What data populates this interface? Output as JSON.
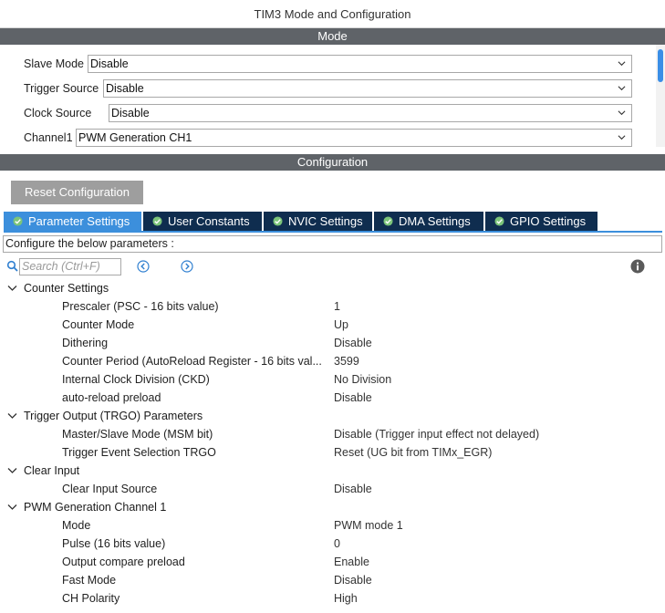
{
  "window": {
    "title": "TIM3 Mode and Configuration"
  },
  "mode_section": {
    "header": "Mode",
    "fields": [
      {
        "label": "Slave Mode",
        "value": "Disable"
      },
      {
        "label": "Trigger Source",
        "value": "Disable"
      },
      {
        "label": "Clock Source",
        "value": "Disable"
      },
      {
        "label": "Channel1",
        "value": "PWM Generation CH1"
      }
    ]
  },
  "config_section": {
    "header": "Configuration",
    "reset_label": "Reset Configuration",
    "tabs": [
      {
        "label": "Parameter Settings",
        "active": true
      },
      {
        "label": "User Constants",
        "active": false
      },
      {
        "label": "NVIC Settings",
        "active": false
      },
      {
        "label": "DMA Settings",
        "active": false
      },
      {
        "label": "GPIO Settings",
        "active": false
      }
    ],
    "description": "Configure the below parameters :",
    "search_placeholder": "Search (Ctrl+F)"
  },
  "groups": [
    {
      "label": "Counter Settings",
      "params": [
        {
          "name": "Prescaler (PSC - 16 bits value)",
          "value": "1"
        },
        {
          "name": "Counter Mode",
          "value": "Up"
        },
        {
          "name": "Dithering",
          "value": "Disable"
        },
        {
          "name": "Counter Period (AutoReload Register - 16 bits val...",
          "value": "3599"
        },
        {
          "name": "Internal Clock Division (CKD)",
          "value": "No Division"
        },
        {
          "name": "auto-reload preload",
          "value": "Disable"
        }
      ]
    },
    {
      "label": "Trigger Output (TRGO) Parameters",
      "params": [
        {
          "name": "Master/Slave Mode (MSM bit)",
          "value": "Disable (Trigger input effect not delayed)"
        },
        {
          "name": "Trigger Event Selection TRGO",
          "value": "Reset (UG bit from TIMx_EGR)"
        }
      ]
    },
    {
      "label": "Clear Input",
      "params": [
        {
          "name": "Clear Input Source",
          "value": "Disable"
        }
      ]
    },
    {
      "label": "PWM Generation Channel 1",
      "params": [
        {
          "name": "Mode",
          "value": "PWM mode 1"
        },
        {
          "name": "Pulse (16 bits value)",
          "value": "0"
        },
        {
          "name": "Output compare preload",
          "value": "Enable"
        },
        {
          "name": "Fast Mode",
          "value": "Disable"
        },
        {
          "name": "CH Polarity",
          "value": "High"
        }
      ]
    }
  ],
  "colors": {
    "section_header": "#5f6368",
    "tab_active": "#3c8fdc",
    "tab_inactive": "#0f2d4f",
    "reset_button": "#9e9e9e",
    "check_green": "#7cc57a",
    "scroll_thumb": "#3a8ee6"
  },
  "icons": {
    "select_arrow": "chevron-down-icon",
    "tab_check": "check-circle-icon",
    "search": "search-icon",
    "nav_prev": "circle-arrow-left-icon",
    "nav_next": "circle-arrow-right-icon",
    "info": "info-icon",
    "group_toggle": "chevron-down-icon"
  }
}
